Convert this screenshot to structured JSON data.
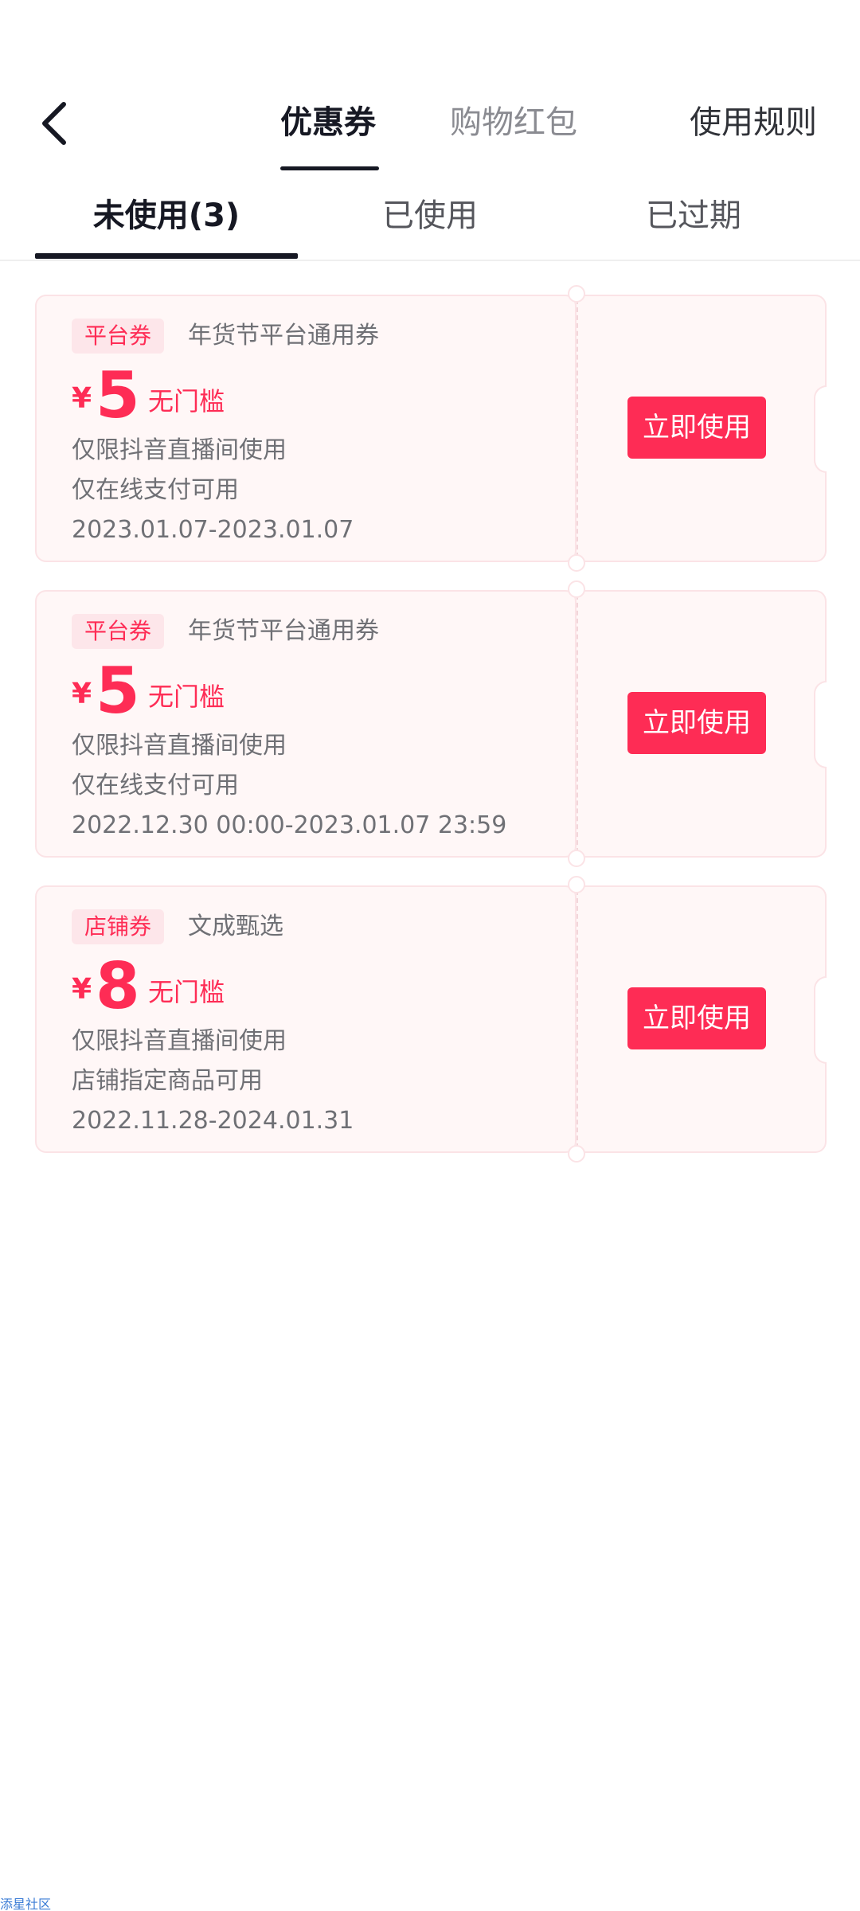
{
  "header": {
    "back_icon": "chevron-left-icon",
    "tabs": [
      {
        "label": "优惠券",
        "active": true
      },
      {
        "label": "购物红包",
        "active": false
      },
      {
        "label": "使用规则",
        "active": false
      }
    ]
  },
  "subtabs": [
    {
      "label": "未使用(3)",
      "active": true
    },
    {
      "label": "已使用",
      "active": false
    },
    {
      "label": "已过期",
      "active": false
    }
  ],
  "colors": {
    "accent": "#fe2c55",
    "text_primary": "#161823",
    "text_secondary": "#6f7075",
    "card_bg": "#fff7f7"
  },
  "coupons": [
    {
      "tag": "平台券",
      "title": "年货节平台通用券",
      "currency": "¥",
      "amount": "5",
      "threshold": "无门槛",
      "line1": "仅限抖音直播间使用",
      "line2": "仅在线支付可用",
      "validity": "2023.01.07-2023.01.07",
      "button": "立即使用"
    },
    {
      "tag": "平台券",
      "title": "年货节平台通用券",
      "currency": "¥",
      "amount": "5",
      "threshold": "无门槛",
      "line1": "仅限抖音直播间使用",
      "line2": "仅在线支付可用",
      "validity": "2022.12.30 00:00-2023.01.07 23:59",
      "button": "立即使用"
    },
    {
      "tag": "店铺券",
      "title": "文成甄选",
      "currency": "¥",
      "amount": "8",
      "threshold": "无门槛",
      "line1": "仅限抖音直播间使用",
      "line2": "店铺指定商品可用",
      "validity": "2022.11.28-2024.01.31",
      "button": "立即使用"
    }
  ],
  "watermark": "添星社区"
}
